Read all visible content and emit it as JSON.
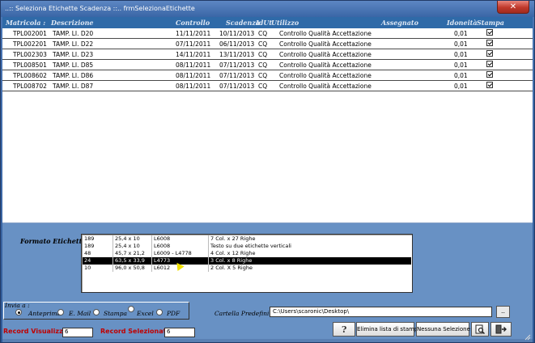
{
  "window": {
    "title": "..:: Seleziona Etichette Scadenza ::..   frmSelezionaEtichette",
    "close_label": "✕"
  },
  "grid": {
    "columns": [
      "Matricola :",
      "Descrizione",
      "Controllo",
      "Scadenza",
      "IdUt",
      "Utilizzo",
      "Assegnato",
      "Idoneità",
      "Stampa"
    ],
    "rows": [
      {
        "matricola": "TPL002001",
        "descrizione": "TAMP. LI. D20",
        "controllo": "11/11/2011",
        "scadenza": "10/11/2013",
        "idut": "CQ",
        "utilizzo": "Controllo Qualità Accettazione",
        "assegnato": "",
        "idoneita": "0,01",
        "stampa": true
      },
      {
        "matricola": "TPL002201",
        "descrizione": "TAMP. LI. D22",
        "controllo": "07/11/2011",
        "scadenza": "06/11/2013",
        "idut": "CQ",
        "utilizzo": "Controllo Qualità Accettazione",
        "assegnato": "",
        "idoneita": "0,01",
        "stampa": true
      },
      {
        "matricola": "TPL002303",
        "descrizione": "TAMP. LI. D23",
        "controllo": "14/11/2011",
        "scadenza": "13/11/2013",
        "idut": "CQ",
        "utilizzo": "Controllo Qualità Accettazione",
        "assegnato": "",
        "idoneita": "0,01",
        "stampa": true
      },
      {
        "matricola": "TPL008501",
        "descrizione": "TAMP. LI. D85",
        "controllo": "08/11/2011",
        "scadenza": "07/11/2013",
        "idut": "CQ",
        "utilizzo": "Controllo Qualità Accettazione",
        "assegnato": "",
        "idoneita": "0,01",
        "stampa": true
      },
      {
        "matricola": "TPL008602",
        "descrizione": "TAMP. LI. D86",
        "controllo": "08/11/2011",
        "scadenza": "07/11/2013",
        "idut": "CQ",
        "utilizzo": "Controllo Qualità Accettazione",
        "assegnato": "",
        "idoneita": "0,01",
        "stampa": true
      },
      {
        "matricola": "TPL008702",
        "descrizione": "TAMP. LI. D87",
        "controllo": "08/11/2011",
        "scadenza": "07/11/2013",
        "idut": "CQ",
        "utilizzo": "Controllo Qualità Accettazione",
        "assegnato": "",
        "idoneita": "0,01",
        "stampa": true
      }
    ]
  },
  "formato": {
    "label": "Formato Etichette :",
    "selected_index": 3,
    "rows": [
      {
        "id": "189",
        "dim": "25,4 x 10",
        "code": "L6008",
        "desc": "7 Col. x 27 Righe"
      },
      {
        "id": "189",
        "dim": "25,4 x 10",
        "code": "L6008",
        "desc": "Testo su due etichette verticali"
      },
      {
        "id": "48",
        "dim": "45,7 x 21,2",
        "code": "L6009 - L4778",
        "desc": "4 Col. x 12 Righe"
      },
      {
        "id": "24",
        "dim": "63,5 x 33,9",
        "code": "L4773",
        "desc": "3 Col. x 8 Righe"
      },
      {
        "id": "10",
        "dim": "96,0 x 50,8",
        "code": "L6012",
        "desc": "2 Col. X 5 Righe"
      }
    ]
  },
  "invia": {
    "label": "Invia a :",
    "options": [
      {
        "label": "Anteprima",
        "selected": true
      },
      {
        "label": "E. Mail",
        "selected": false
      },
      {
        "label": "Stampa",
        "selected": false
      },
      {
        "label": "Excel",
        "selected": false
      },
      {
        "label": "PDF",
        "selected": false
      }
    ]
  },
  "cartella": {
    "label": "Cartella Predefinita :",
    "value": "C:\\Users\\scaronic\\Desktop\\",
    "browse_label": ".."
  },
  "records": {
    "visualizzati_label": "Record Visualizzati :",
    "visualizzati_value": "6",
    "selezionati_label": "Record Selezionati :",
    "selezionati_value": "6"
  },
  "buttons": {
    "elimina_label": "Elimina lista di stampa",
    "nessuna_label": "Nessuna Selezione"
  },
  "icons": {
    "help": "help-icon",
    "preview": "print-preview-icon",
    "exit": "exit-door-icon"
  }
}
